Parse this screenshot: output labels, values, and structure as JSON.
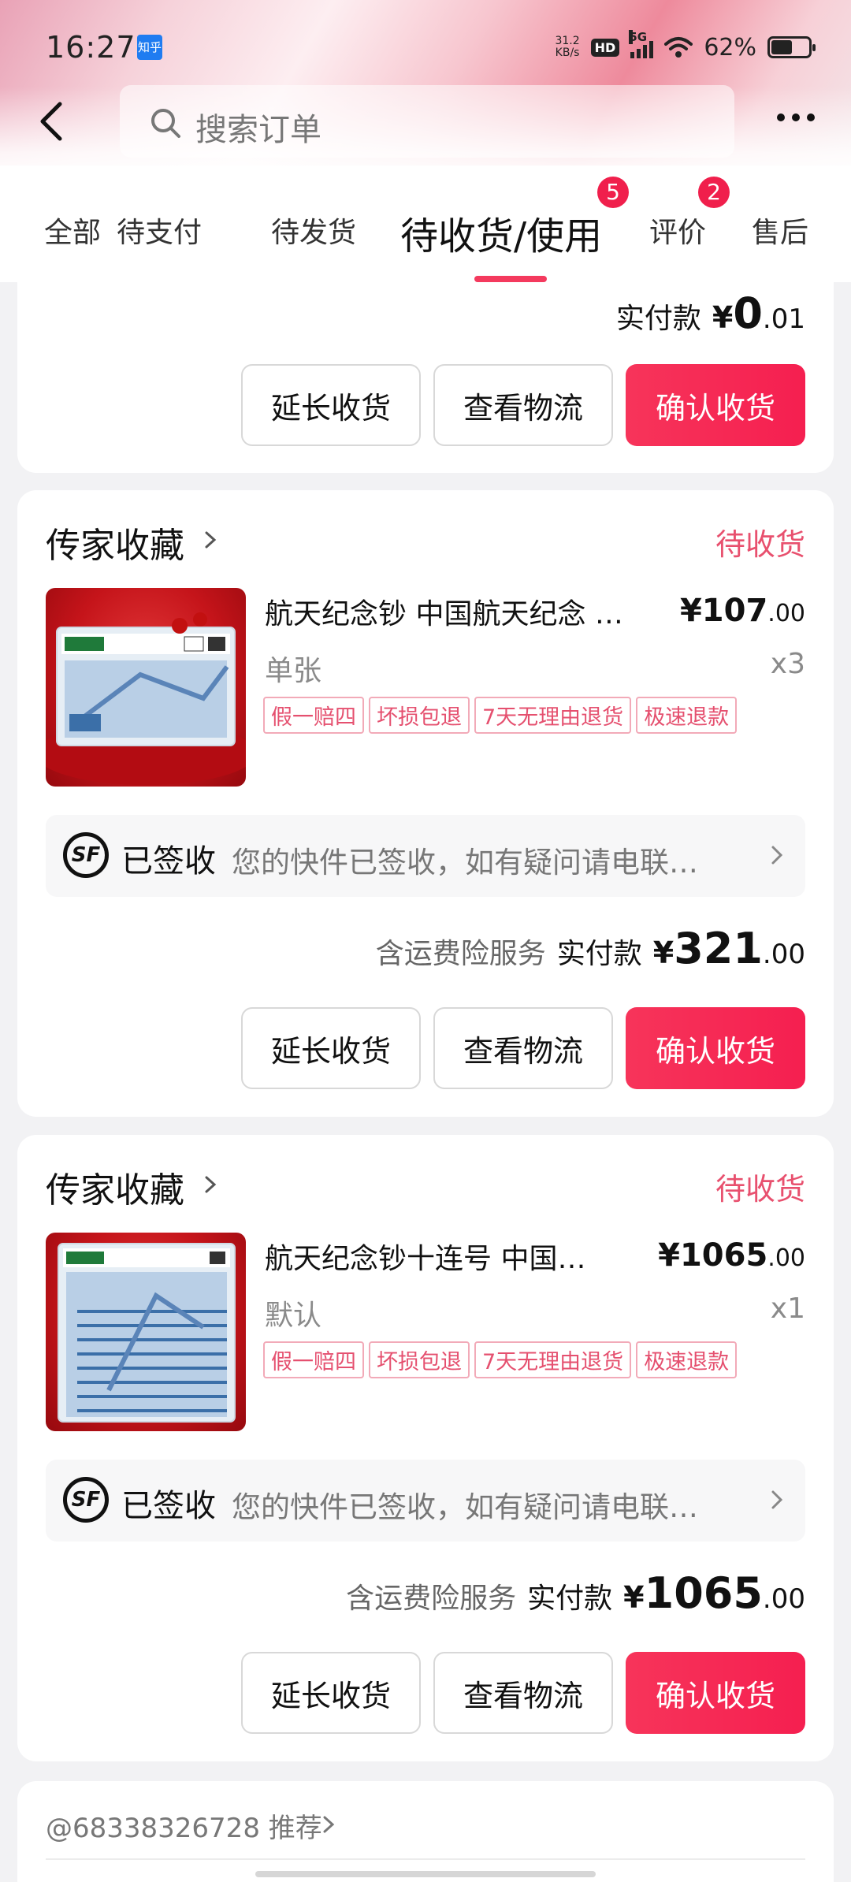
{
  "status_bar": {
    "time": "16:27",
    "app_badge": "知乎",
    "net_speed_value": "31.2",
    "net_speed_unit": "KB/s",
    "hd": "HD",
    "signal_label": "5G",
    "battery": "62%"
  },
  "search": {
    "placeholder": "搜索订单"
  },
  "tabs": [
    {
      "label": "全部"
    },
    {
      "label": "待支付"
    },
    {
      "label": "待发货"
    },
    {
      "label": "待收货/使用",
      "badge": "5",
      "active": true
    },
    {
      "label": "评价",
      "badge": "2"
    },
    {
      "label": "售后"
    }
  ],
  "top_card": {
    "pay_label": "实付款",
    "amount_int": "0",
    "amount_dec": ".01",
    "buttons": {
      "extend": "延长收货",
      "logistics": "查看物流",
      "confirm": "确认收货"
    }
  },
  "orders": [
    {
      "shop": "传家收藏",
      "status": "待收货",
      "title": "航天纪念钞 中国航天纪念 …",
      "price_int": "107",
      "price_dec": ".00",
      "spec": "单张",
      "qty": "x3",
      "tags": [
        "假一赔四",
        "坏损包退",
        "7天无理由退货",
        "极速退款"
      ],
      "log_status": "已签收",
      "log_msg": "您的快件已签收，如有疑问请电联…",
      "insurance": "含运费险服务",
      "pay_label": "实付款",
      "pay_int": "321",
      "pay_dec": ".00",
      "buttons": {
        "extend": "延长收货",
        "logistics": "查看物流",
        "confirm": "确认收货"
      }
    },
    {
      "shop": "传家收藏",
      "status": "待收货",
      "title": "航天纪念钞十连号 中国…",
      "price_int": "1065",
      "price_dec": ".00",
      "spec": "默认",
      "qty": "x1",
      "tags": [
        "假一赔四",
        "坏损包退",
        "7天无理由退货",
        "极速退款"
      ],
      "log_status": "已签收",
      "log_msg": "您的快件已签收，如有疑问请电联…",
      "insurance": "含运费险服务",
      "pay_label": "实付款",
      "pay_int": "1065",
      "pay_dec": ".00",
      "buttons": {
        "extend": "延长收货",
        "logistics": "查看物流",
        "confirm": "确认收货"
      }
    }
  ],
  "currency": "¥",
  "recommend": {
    "text": "@68338326728 推荐"
  },
  "colors": {
    "accent": "#f51f50",
    "status": "#e8506e",
    "badge": "#f01f4c"
  }
}
